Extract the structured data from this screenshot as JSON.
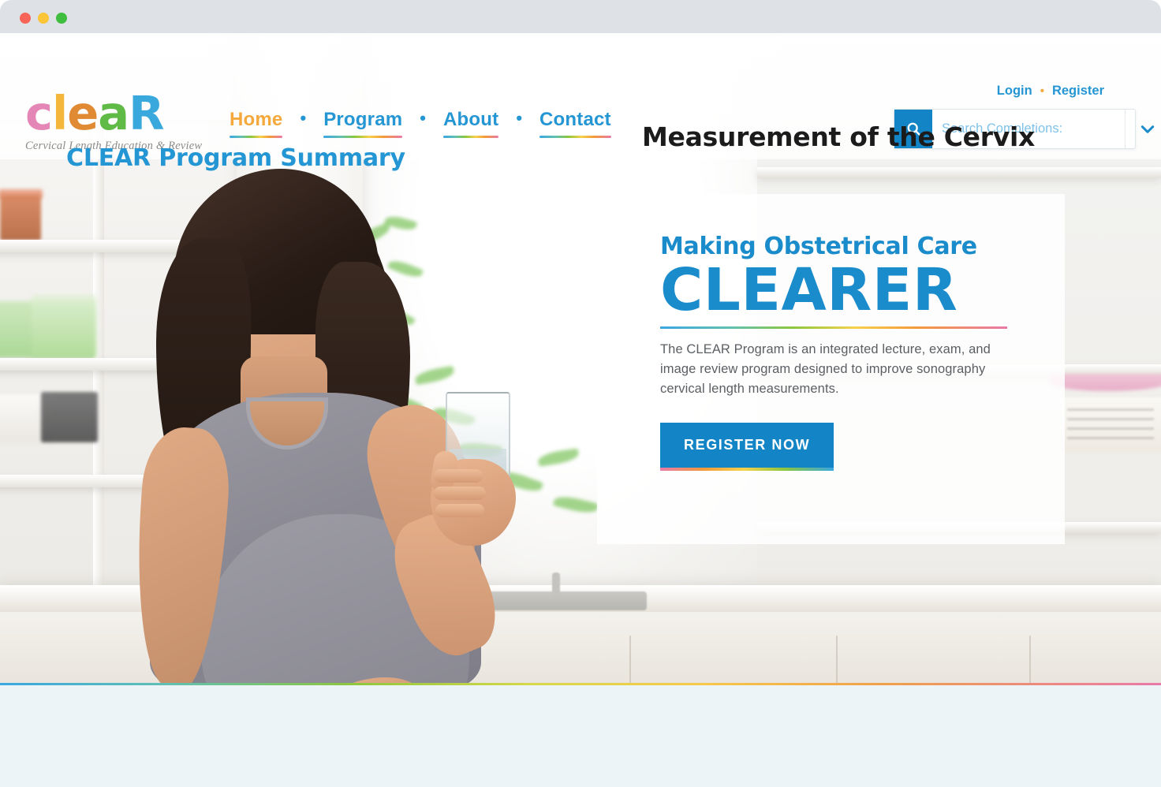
{
  "window": {
    "traffic_lights": [
      {
        "name": "close",
        "color": "#f96459"
      },
      {
        "name": "minimize",
        "color": "#fac536"
      },
      {
        "name": "maximize",
        "color": "#3fbd3e"
      }
    ]
  },
  "brand": {
    "word": "clear",
    "letters": [
      {
        "char": "c",
        "color": "#e486b6"
      },
      {
        "char": "l",
        "color": "#f5b63c"
      },
      {
        "char": "e",
        "color": "#e08b33"
      },
      {
        "char": "a",
        "color": "#5fba46"
      },
      {
        "char": "R",
        "color": "#39a8dd"
      }
    ],
    "tagline": "Cervical Length Education & Review"
  },
  "nav": {
    "separator": "•",
    "items": [
      {
        "label": "Home",
        "active": true
      },
      {
        "label": "Program",
        "active": false
      },
      {
        "label": "About",
        "active": false
      },
      {
        "label": "Contact",
        "active": false
      }
    ]
  },
  "account": {
    "login": "Login",
    "separator": "•",
    "register": "Register"
  },
  "search": {
    "placeholder": "Search Completions:",
    "value": "",
    "icon": "search-icon",
    "caret_icon": "chevron-down-icon",
    "button_color": "#1384c6"
  },
  "hero": {
    "kicker": "Making Obstetrical Care",
    "headline": "CLEARER",
    "body": "The CLEAR Program is an integrated lecture, exam, and image review program designed to improve sonography cervical length measurements.",
    "cta_label": "REGISTER NOW",
    "cta_color": "#1384c6"
  },
  "lower": {
    "program_summary_title": "CLEAR Program Summary",
    "measurement_title": "Measurement of the Cervix",
    "background_color": "#ecf4f8"
  },
  "colors": {
    "brand_blue": "#2596d4",
    "accent_orange": "#f5a93c",
    "rainbow": [
      "#3aa7e0",
      "#8cc63f",
      "#f6d14b",
      "#f39a3c",
      "#e87aa8"
    ]
  }
}
